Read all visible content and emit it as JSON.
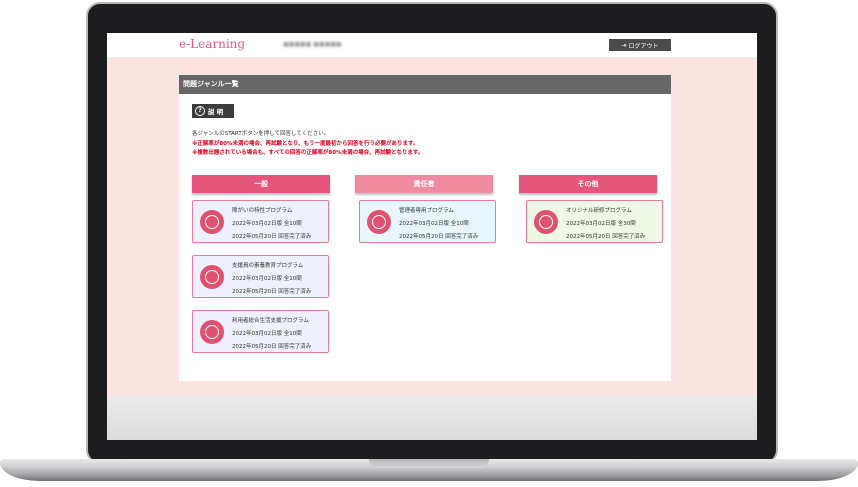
{
  "header": {
    "logo": "e-Learning",
    "user_name": "■■■■■ ■■■■■",
    "logout_label": "ログアウト"
  },
  "panel": {
    "title": "問題ジャンル一覧",
    "help_label": "説 明",
    "instructions": "各ジャンルのSTARTボタンを押して回答してください。",
    "notice_1": "※正解率が80%未満の場合、再試験となり、もう一度最初から回答を行う必要があります。",
    "notice_2": "※複数出題されている場合も、すべての回答の正解率が80%未満の場合、再試験となります。"
  },
  "columns": [
    {
      "label": "一般",
      "color": "#e5557a"
    },
    {
      "label": "責任者",
      "color": "#f08a9e"
    },
    {
      "label": "その他",
      "color": "#e5557a"
    }
  ],
  "cards": [
    {
      "title": "障がいの特性プログラム",
      "version": "2022年03月02日版 全10問",
      "status": "2022年05月20日 回答完了済み",
      "bg": "#eef1fb"
    },
    {
      "title": "支援員の素養教育プログラム",
      "version": "2022年03月02日版 全10問",
      "status": "2022年05月20日 回答完了済み",
      "bg": "#eef1fb"
    },
    {
      "title": "利用者総合生活支援プログラム",
      "version": "2022年03月02日版 全10問",
      "status": "2022年05月20日 回答完了済み",
      "bg": "#eef1fb"
    },
    {
      "title": "管理者専用プログラム",
      "version": "2022年03月02日版 全10問",
      "status": "2022年05月20日 回答完了済み",
      "bg": "#e8f6fb"
    },
    {
      "title": "オリジナル研修プログラム",
      "version": "2022年03月02日版 全30問",
      "status": "2022年05月20日 回答完了済み",
      "bg": "#eff8e6"
    }
  ]
}
